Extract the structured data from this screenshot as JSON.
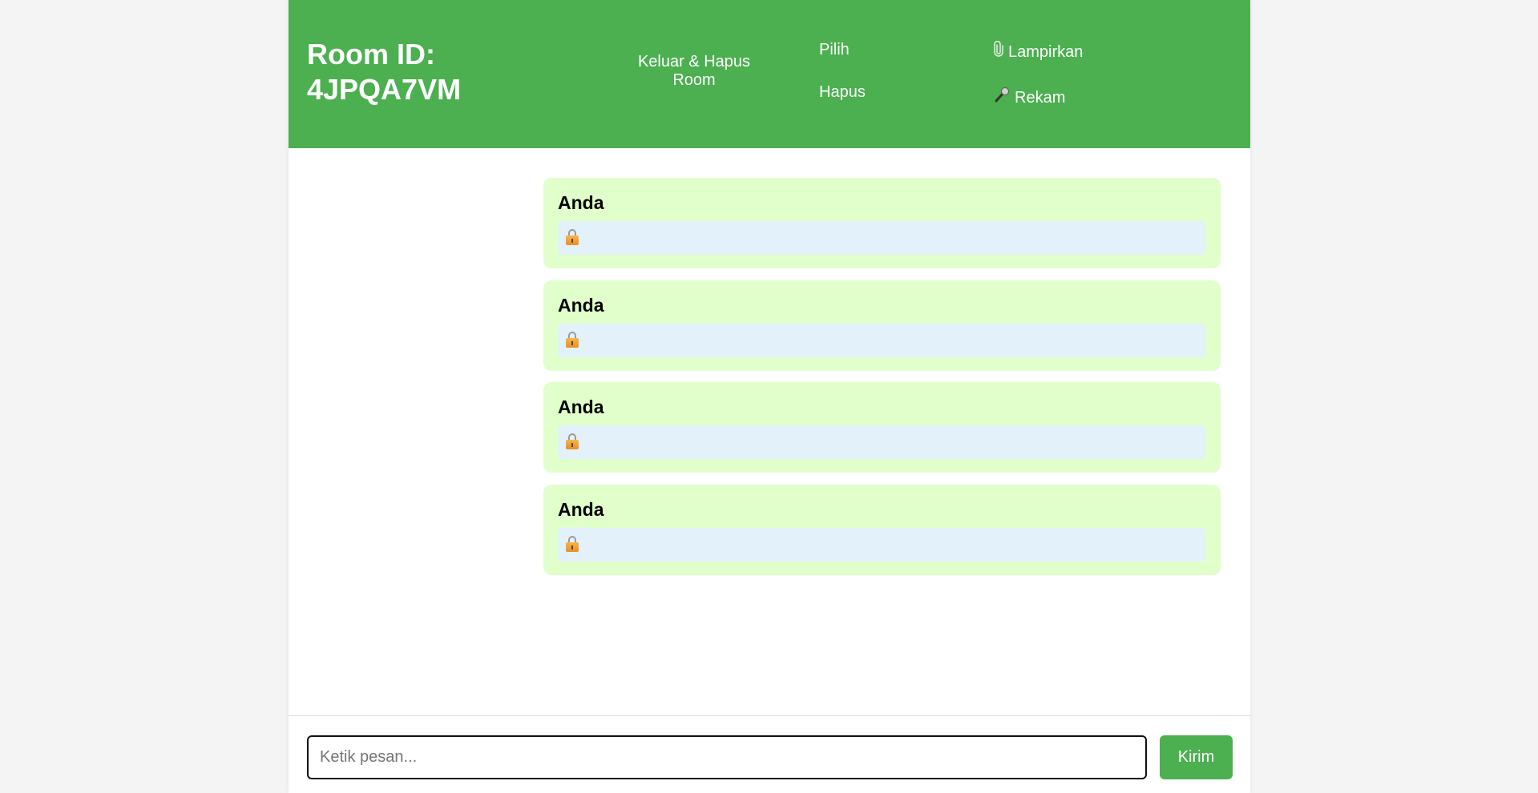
{
  "header": {
    "room_label": "Room ID: 4JPQA7VM",
    "leave_delete_label": "Keluar & Hapus Room",
    "select_label": "Pilih",
    "delete_label": "Hapus",
    "attach_label": "Lampirkan",
    "attach_icon": "paperclip-icon",
    "record_label": "Rekam",
    "record_icon": "microphone-icon"
  },
  "messages": [
    {
      "sender": "Anda",
      "content_icon": "lock-icon"
    },
    {
      "sender": "Anda",
      "content_icon": "lock-icon"
    },
    {
      "sender": "Anda",
      "content_icon": "lock-icon"
    },
    {
      "sender": "Anda",
      "content_icon": "lock-icon"
    }
  ],
  "composer": {
    "placeholder": "Ketik pesan...",
    "value": "",
    "send_label": "Kirim"
  },
  "colors": {
    "header_bg": "#4caf50",
    "own_message_bg": "#e1ffcb",
    "message_body_bg": "#e3f1fb",
    "send_button_bg": "#4caf50"
  }
}
